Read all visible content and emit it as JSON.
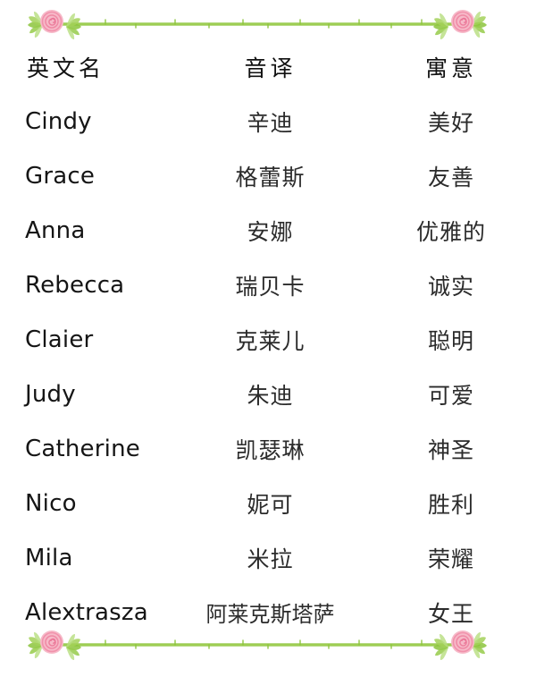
{
  "decoration": {
    "top_divider": "rose-vine-divider",
    "bottom_divider": "rose-vine-divider",
    "rose_color": "#f4a0b5",
    "rose_inner_color": "#fad2dc",
    "leaf_color": "#8cc43c",
    "leaf_light_color": "#b6dd7e",
    "vine_color": "#8cc43c"
  },
  "table": {
    "headers": {
      "english": "英文名",
      "translit": "音译",
      "meaning": "寓意"
    },
    "rows": [
      {
        "english": "Cindy",
        "translit": "辛迪",
        "meaning": "美好"
      },
      {
        "english": "Grace",
        "translit": "格蕾斯",
        "meaning": "友善"
      },
      {
        "english": "Anna",
        "translit": "安娜",
        "meaning": "优雅的"
      },
      {
        "english": "Rebecca",
        "translit": "瑞贝卡",
        "meaning": "诚实"
      },
      {
        "english": "Claier",
        "translit": "克莱儿",
        "meaning": "聪明"
      },
      {
        "english": "Judy",
        "translit": "朱迪",
        "meaning": "可爱"
      },
      {
        "english": "Catherine",
        "translit": "凯瑟琳",
        "meaning": "神圣"
      },
      {
        "english": "Nico",
        "translit": "妮可",
        "meaning": "胜利"
      },
      {
        "english": "Mila",
        "translit": "米拉",
        "meaning": "荣耀"
      },
      {
        "english": "Alextrasza",
        "translit": "阿莱克斯塔萨",
        "meaning": "女王"
      }
    ]
  }
}
